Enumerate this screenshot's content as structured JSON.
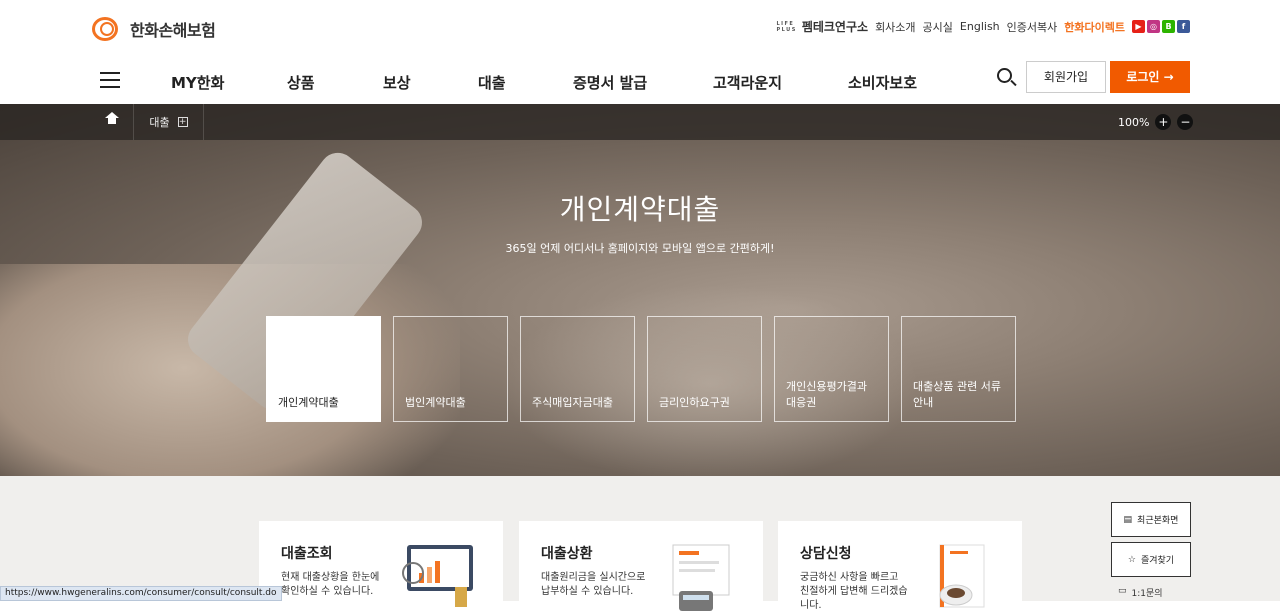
{
  "header": {
    "logo_text": "한화손해보험",
    "util": {
      "lifeplus_top": "LIFE",
      "lifeplus_bottom": "PLUS",
      "fintech": "펨테크연구소",
      "links": [
        "회사소개",
        "공시실",
        "English",
        "인증서복사"
      ],
      "direct": "한화다이렉트"
    },
    "sns": [
      {
        "name": "youtube-icon",
        "glyph": "▶",
        "color": "#e62117"
      },
      {
        "name": "instagram-icon",
        "glyph": "◎",
        "color": "#c13584"
      },
      {
        "name": "blog-icon",
        "glyph": "B",
        "color": "#2db400"
      },
      {
        "name": "facebook-icon",
        "glyph": "f",
        "color": "#3b5998"
      }
    ],
    "nav": [
      "MY한화",
      "상품",
      "보상",
      "대출",
      "증명서 발급",
      "고객라운지",
      "소비자보호"
    ],
    "join_label": "회원가입",
    "login_label": "로그인 →"
  },
  "breadcrumb": {
    "item": "대출",
    "plus": "+",
    "zoom": "100%",
    "zoom_in": "+",
    "zoom_out": "−"
  },
  "hero": {
    "title": "개인계약대출",
    "subtitle": "365일 언제 어디서나 홈페이지와 모바일 앱으로 간편하게!",
    "tabs": [
      "개인계약대출",
      "법인계약대출",
      "주식매입자금대출",
      "금리인하요구권",
      "개인신용평가결과 대응권",
      "대출상품 관련 서류 안내"
    ]
  },
  "cards": [
    {
      "title": "대출조회",
      "desc": "현재 대출상황을 한눈에 확인하실 수 있습니다."
    },
    {
      "title": "대출상환",
      "desc": "대출원리금을 실시간으로 납부하실 수 있습니다."
    },
    {
      "title": "상담신청",
      "desc": "궁금하신 사항을 빠르고 친절하게 답변해 드리겠습니다."
    }
  ],
  "quick_menu": {
    "recent": "최근본화면",
    "favorite": "즐겨찾기",
    "inquiry": "1:1문의"
  },
  "status_url": "https://www.hwgeneralins.com/consumer/consult/consult.do",
  "colors": {
    "accent": "#f15a00",
    "brand": "#f37321"
  }
}
